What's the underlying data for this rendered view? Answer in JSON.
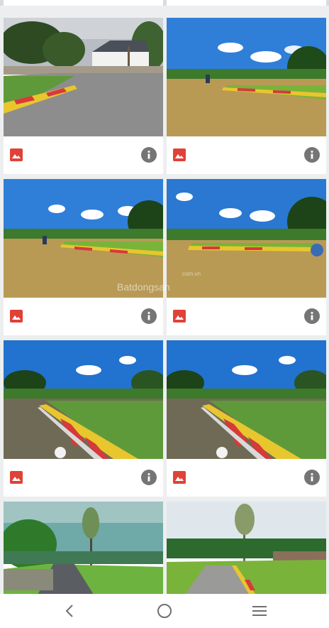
{
  "gallery": {
    "items": [
      {
        "caption": "",
        "has_info": true
      },
      {
        "caption": "",
        "has_info": true
      },
      {
        "caption": "",
        "has_info": true
      },
      {
        "caption": "",
        "has_info": true
      },
      {
        "caption": "",
        "has_info": true
      },
      {
        "caption": "",
        "has_info": true
      },
      {
        "caption": "",
        "has_info": false
      },
      {
        "caption": "",
        "has_info": false
      }
    ],
    "watermark": "Batdongsan",
    "watermark_sub": ".com.vn"
  },
  "icons": {
    "image": "image-icon",
    "info": "info-icon",
    "back": "back-icon",
    "home": "home-icon",
    "recents": "recents-icon"
  },
  "colors": {
    "image_icon": "#e04238",
    "info_icon": "#757575",
    "nav_icon": "#6f6f6f"
  }
}
